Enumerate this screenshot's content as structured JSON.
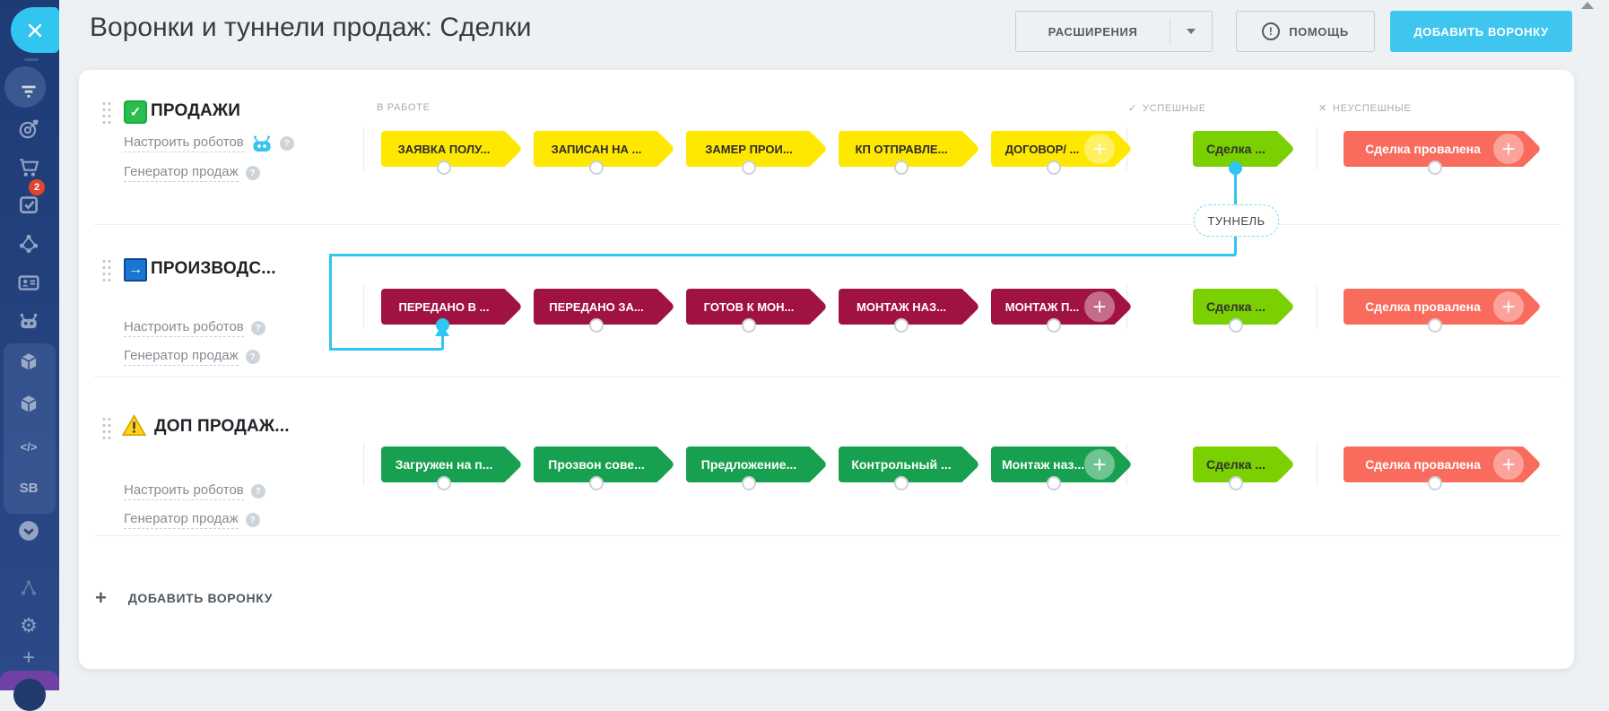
{
  "header": {
    "title": "Воронки и туннели продаж: Сделки",
    "extensions_button": "РАСШИРЕНИЯ",
    "help_button": "ПОМОЩЬ",
    "add_funnel_button": "ДОБАВИТЬ ВОРОНКУ"
  },
  "sidebar": {
    "badge_count": "2",
    "sb_label": "SB",
    "code_label": "</>"
  },
  "icons": {
    "check": "✓",
    "cross": "✕",
    "arrow_right": "→",
    "plus": "+",
    "question": "?",
    "exclamation": "!",
    "warning": "!",
    "gear": "⚙"
  },
  "columns": {
    "in_progress": "В РАБОТЕ",
    "successful": "УСПЕШНЫЕ",
    "unsuccessful": "НЕУСПЕШНЫЕ"
  },
  "tunnel_label": "ТУННЕЛЬ",
  "funnels": [
    {
      "title": "ПРОДАЖИ",
      "robots_link": "Настроить роботов",
      "generator_link": "Генератор продаж",
      "stages": [
        "ЗАЯВКА ПОЛУ...",
        "ЗАПИСАН НА ...",
        "ЗАМЕР ПРОИ...",
        "КП ОТПРАВЛЕ...",
        "ДОГОВОР/ ..."
      ],
      "success_stage": "Сделка ...",
      "fail_stage": "Сделка провалена"
    },
    {
      "title": "ПРОИЗВОДС...",
      "robots_link": "Настроить роботов",
      "generator_link": "Генератор продаж",
      "stages": [
        "ПЕРЕДАНО В ...",
        "ПЕРЕДАНО ЗА...",
        "ГОТОВ К МОН...",
        "МОНТАЖ НАЗ...",
        "МОНТАЖ П..."
      ],
      "success_stage": "Сделка ...",
      "fail_stage": "Сделка провалена"
    },
    {
      "title": "ДОП ПРОДАЖ...",
      "robots_link": "Настроить роботов",
      "generator_link": "Генератор продаж",
      "stages": [
        "Загружен на п...",
        "Прозвон сове...",
        "Предложение...",
        "Контрольный ...",
        "Монтаж наз..."
      ],
      "success_stage": "Сделка ...",
      "fail_stage": "Сделка провалена"
    }
  ],
  "footer": {
    "add_funnel_link": "ДОБАВИТЬ ВОРОНКУ"
  },
  "colors": {
    "accent_cyan": "#2fc7f1",
    "button_cyan": "#3fc6ef",
    "stage_yellow": "#ffe800",
    "stage_maroon": "#a11244",
    "stage_green": "#17a04f",
    "stage_lime": "#7ad000",
    "stage_red": "#f96b5c",
    "sidebar_navy": "#1d3b76"
  }
}
